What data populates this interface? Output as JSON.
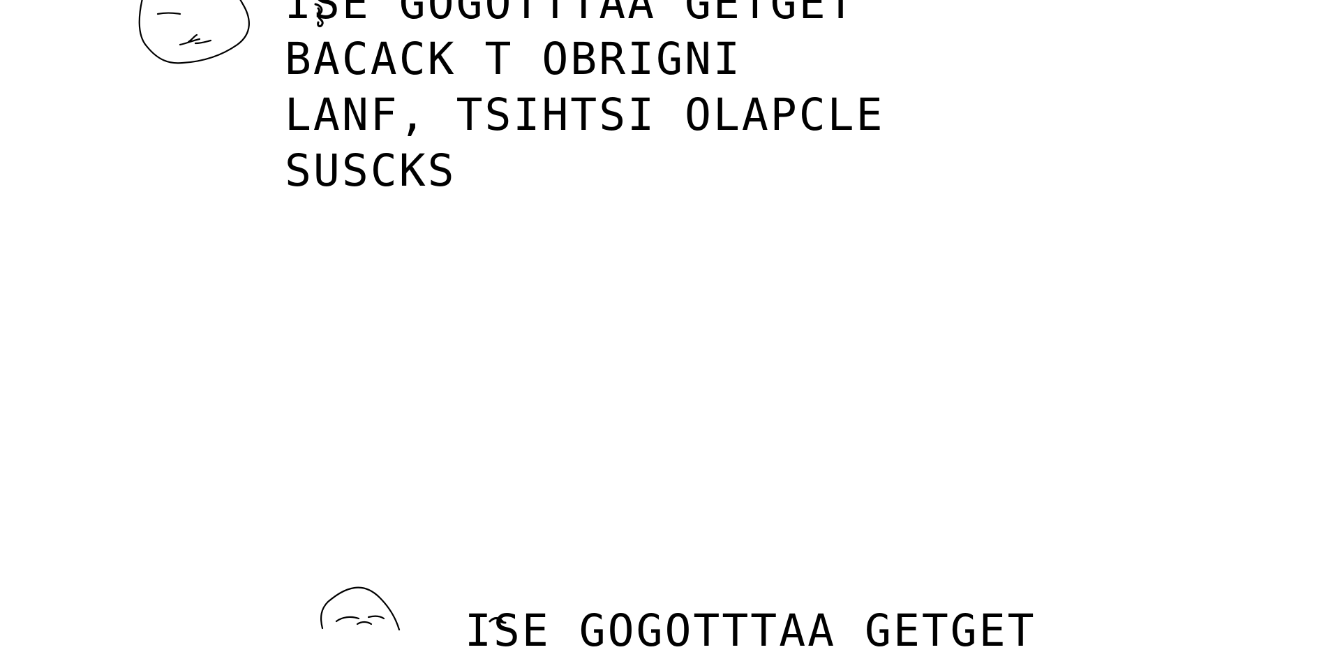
{
  "top_block": {
    "face_icon": "rage-face-sketch-icon",
    "lines": [
      "ISE GOGOTTTAA GETGET",
      "BACACK T OBRIGNI",
      "LANF, TSIHTSI OLAPCLE",
      "SUSCKS"
    ]
  },
  "bottom_block": {
    "face_icon": "rage-face-sketch-icon",
    "lines": [
      "ISE GOGOTTTAA GETGET"
    ]
  }
}
